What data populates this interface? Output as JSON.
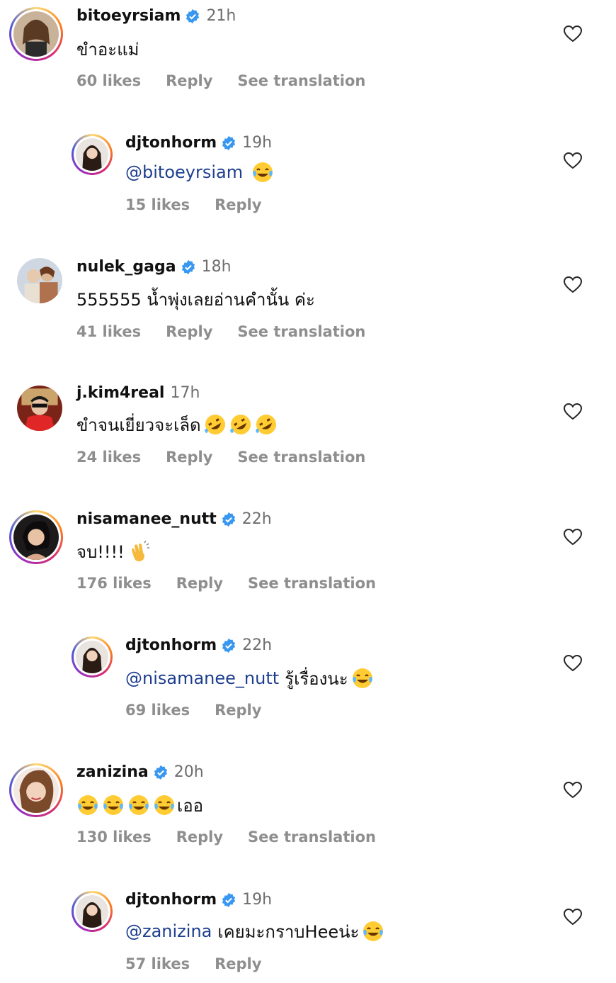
{
  "comments": [
    {
      "username": "bitoeyrsiam",
      "verified": true,
      "time": "21h",
      "mention": "",
      "text": "ขำอะแม่",
      "emoji": [],
      "likes": "60 likes",
      "reply": "Reply",
      "translate": "See translation",
      "avatar_icon": "profile-photo",
      "avatar_ring": true
    },
    {
      "username": "djtonhorm",
      "verified": true,
      "time": "19h",
      "mention": "@bitoeyrsiam",
      "text": "",
      "emoji": [
        "tears-of-joy"
      ],
      "likes": "15 likes",
      "reply": "Reply",
      "translate": "",
      "avatar_icon": "profile-photo",
      "avatar_ring": true
    },
    {
      "username": "nulek_gaga",
      "verified": true,
      "time": "18h",
      "mention": "",
      "text": "555555 น้ำพุ่งเลยอ่านคำนั้น ค่ะ",
      "emoji": [],
      "likes": "41 likes",
      "reply": "Reply",
      "translate": "See translation",
      "avatar_icon": "profile-photo",
      "avatar_ring": false
    },
    {
      "username": "j.kim4real",
      "verified": false,
      "time": "17h",
      "mention": "",
      "text": "ขำจนเยี่ยวจะเล็ด",
      "emoji": [
        "rolling-on-floor-laughing",
        "rolling-on-floor-laughing",
        "rolling-on-floor-laughing"
      ],
      "likes": "24 likes",
      "reply": "Reply",
      "translate": "See translation",
      "avatar_icon": "profile-photo",
      "avatar_ring": false
    },
    {
      "username": "nisamanee_nutt",
      "verified": true,
      "time": "22h",
      "mention": "",
      "text": "จบ!!!!",
      "emoji": [
        "clapping-hands"
      ],
      "likes": "176 likes",
      "reply": "Reply",
      "translate": "See translation",
      "avatar_icon": "profile-photo",
      "avatar_ring": true
    },
    {
      "username": "djtonhorm",
      "verified": true,
      "time": "22h",
      "mention": "@nisamanee_nutt",
      "text": "รู้เรื่องนะ",
      "emoji": [
        "tears-of-joy"
      ],
      "likes": "69 likes",
      "reply": "Reply",
      "translate": "",
      "avatar_icon": "profile-photo",
      "avatar_ring": true
    },
    {
      "username": "zanizina",
      "verified": true,
      "time": "20h",
      "mention": "",
      "text": "",
      "emoji": [
        "tears-of-joy",
        "tears-of-joy",
        "tears-of-joy",
        "tears-of-joy"
      ],
      "text_after": "เออ",
      "likes": "130 likes",
      "reply": "Reply",
      "translate": "See translation",
      "avatar_icon": "profile-photo",
      "avatar_ring": true
    },
    {
      "username": "djtonhorm",
      "verified": true,
      "time": "19h",
      "mention": "@zanizina",
      "text": "เคยมะกราบHeeน่ะ",
      "emoji": [
        "tears-of-joy"
      ],
      "likes": "57 likes",
      "reply": "Reply",
      "translate": "",
      "avatar_icon": "profile-photo",
      "avatar_ring": true
    }
  ],
  "colors": {
    "username": "#111111",
    "meta": "#8e8e8e",
    "mention": "#1e3f8f",
    "verified": "#3897f0",
    "heart_outline": "#262626"
  },
  "icons": {
    "verified": "verified-badge-icon",
    "like": "heart-outline-icon"
  }
}
